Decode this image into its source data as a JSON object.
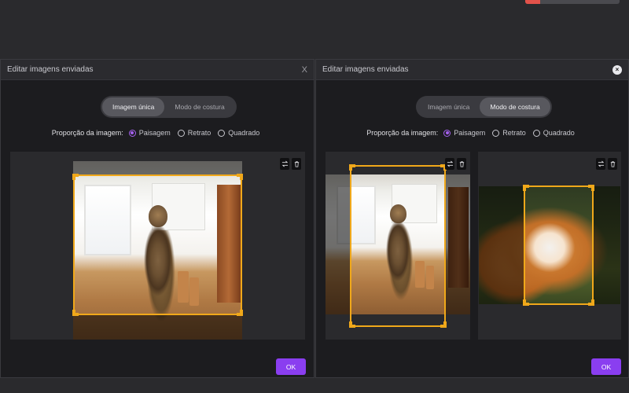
{
  "top_progress": {
    "fraction": 0.16,
    "color": "#e2524a"
  },
  "dialogs": [
    {
      "title": "Editar imagens enviadas",
      "close_glyph": "X",
      "mode_tabs": [
        {
          "label": "Imagem única",
          "active": true
        },
        {
          "label": "Modo de costura",
          "active": false
        }
      ],
      "ratio_label": "Proporção da imagem:",
      "ratio_options": [
        {
          "label": "Paisagem",
          "selected": true
        },
        {
          "label": "Retrato",
          "selected": false
        },
        {
          "label": "Quadrado",
          "selected": false
        }
      ],
      "ok_label": "OK"
    },
    {
      "title": "Editar imagens enviadas",
      "close_icon": "close-circle-icon",
      "mode_tabs": [
        {
          "label": "Imagem única",
          "active": false
        },
        {
          "label": "Modo de costura",
          "active": true
        }
      ],
      "ratio_label": "Proporção da imagem:",
      "ratio_options": [
        {
          "label": "Paisagem",
          "selected": true
        },
        {
          "label": "Retrato",
          "selected": false
        },
        {
          "label": "Quadrado",
          "selected": false
        }
      ],
      "ok_label": "OK"
    }
  ],
  "colors": {
    "accent": "#a561f0",
    "ok_button": "#8a3ef0",
    "crop_frame": "#f0a81a"
  },
  "icons": [
    "swap-icon",
    "trash-icon"
  ]
}
